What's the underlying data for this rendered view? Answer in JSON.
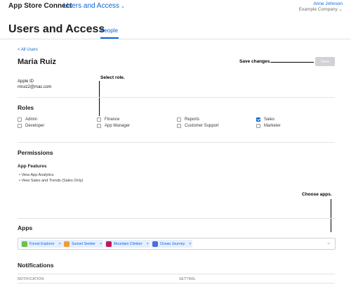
{
  "header": {
    "brand": "App Store Connect",
    "section": "Users and Access",
    "account_name": "Anne Johnson",
    "account_org": "Example Company"
  },
  "page": {
    "title": "Users and Access",
    "tab_people": "People"
  },
  "user": {
    "back_link": "< All Users",
    "name": "Maria Ruiz",
    "save_label": "Save",
    "apple_id_label": "Apple ID",
    "apple_id_value": "mruiz2@mac.com"
  },
  "callouts": {
    "save": "Save changes.",
    "role": "Select role.",
    "apps": "Choose apps."
  },
  "roles": {
    "heading": "Roles",
    "items": [
      {
        "label": "Admin",
        "checked": false
      },
      {
        "label": "Finance",
        "checked": false
      },
      {
        "label": "Reports",
        "checked": false
      },
      {
        "label": "Sales",
        "checked": true
      },
      {
        "label": "Developer",
        "checked": false
      },
      {
        "label": "App Manager",
        "checked": false
      },
      {
        "label": "Customer Support",
        "checked": false
      },
      {
        "label": "Marketer",
        "checked": false
      }
    ]
  },
  "permissions": {
    "heading": "Permissions",
    "subheading": "App Features",
    "items": [
      "View App Analytics",
      "View Sales and Trends (Sales Only)"
    ]
  },
  "apps": {
    "heading": "Apps",
    "chips": [
      {
        "label": "Forest Explorer",
        "color": "#6cc04a"
      },
      {
        "label": "Sunset Seeker",
        "color": "#f29a3b"
      },
      {
        "label": "Mountain Climber",
        "color": "#c2185b"
      },
      {
        "label": "Ocean Journey",
        "color": "#4a6fd6"
      }
    ],
    "remove_symbol": "×",
    "chevron_icon": "chevron-down-icon"
  },
  "notifications": {
    "heading": "Notifications",
    "col_notification": "NOTIFICATION",
    "col_setting": "SETTING"
  },
  "colors": {
    "accent": "#0a66d8",
    "save_disabled": "#d1d1d6"
  }
}
